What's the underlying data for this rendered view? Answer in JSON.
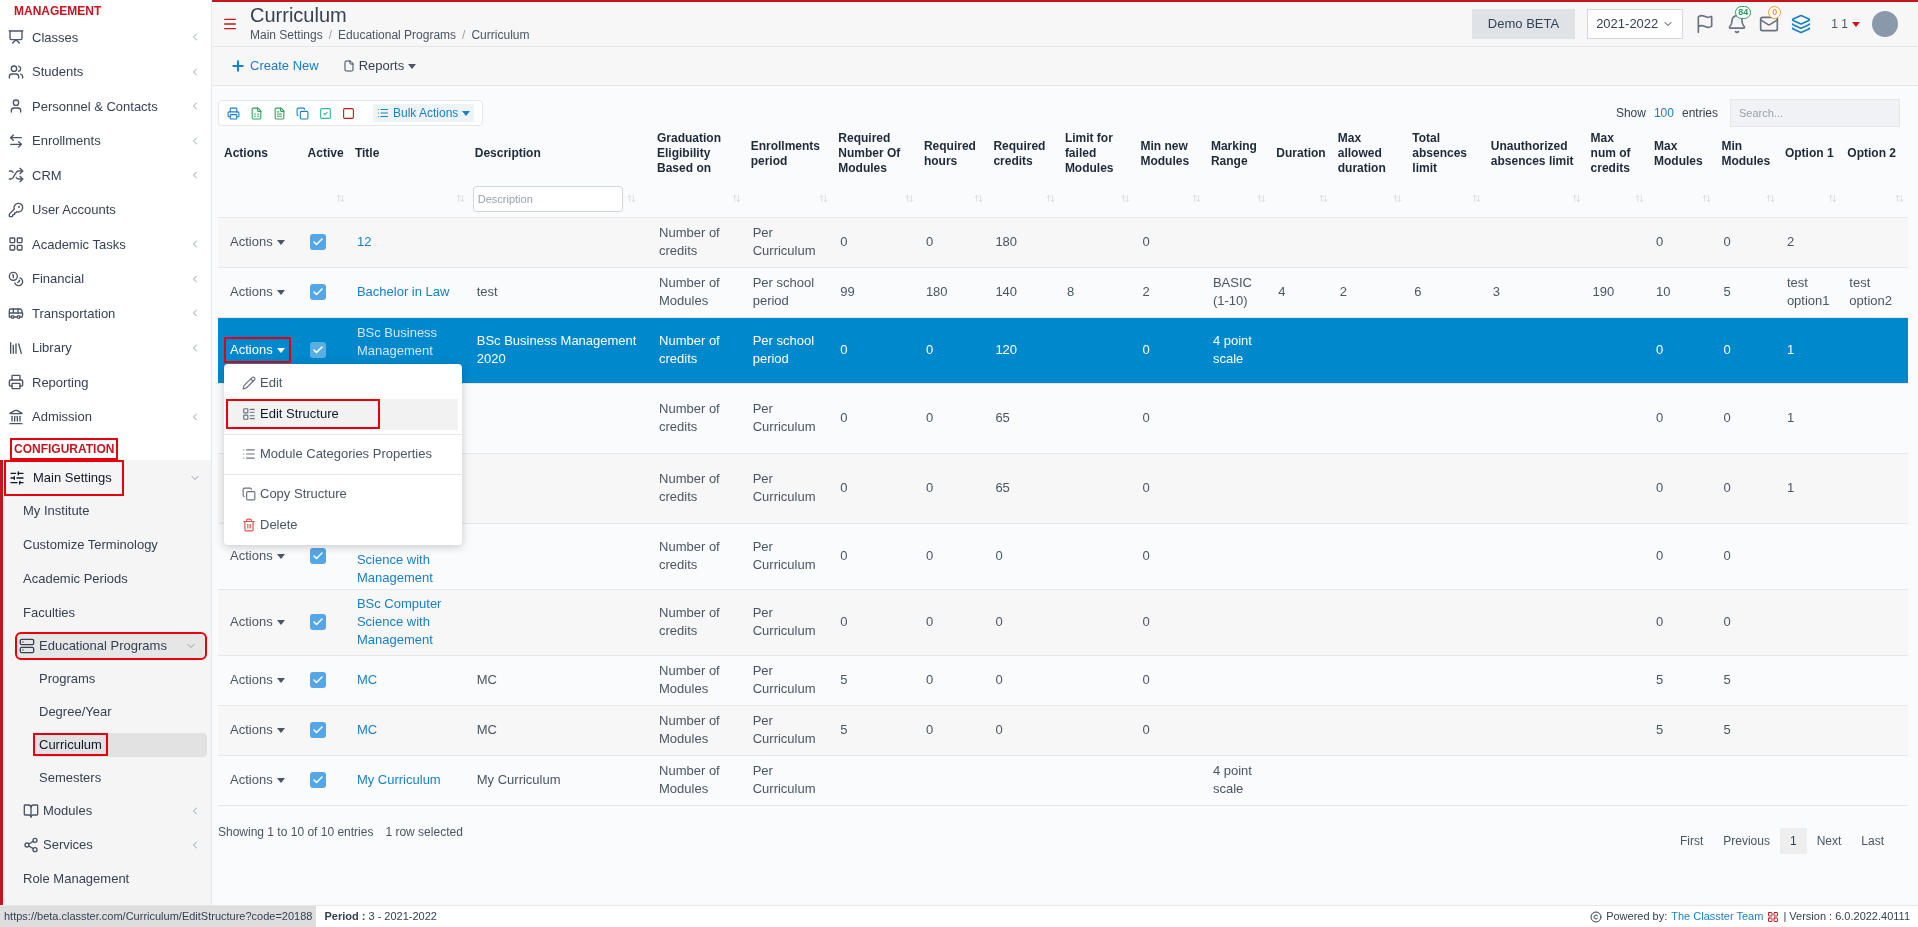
{
  "sidebar": {
    "sections": [
      {
        "heading": "MANAGEMENT",
        "annotated": false,
        "items": [
          {
            "label": "Classes",
            "expanded": false
          },
          {
            "label": "Students",
            "expanded": false
          },
          {
            "label": "Personnel & Contacts",
            "expanded": false
          },
          {
            "label": "Enrollments",
            "expanded": false
          },
          {
            "label": "CRM",
            "expanded": false
          },
          {
            "label": "User Accounts"
          },
          {
            "label": "Academic Tasks",
            "expanded": false
          },
          {
            "label": "Financial",
            "expanded": false
          },
          {
            "label": "Transportation",
            "expanded": false
          },
          {
            "label": "Library",
            "expanded": false
          },
          {
            "label": "Reporting"
          },
          {
            "label": "Admission",
            "expanded": false
          }
        ]
      },
      {
        "heading": "CONFIGURATION",
        "annotated": true,
        "items": [
          {
            "label": "Main Settings",
            "expanded": true,
            "annotated": true,
            "children": [
              {
                "label": "My Institute"
              },
              {
                "label": "Customize Terminology"
              },
              {
                "label": "Academic Periods"
              },
              {
                "label": "Faculties"
              },
              {
                "label": "Educational Programs",
                "expanded": true,
                "annotated": true,
                "children": [
                  {
                    "label": "Programs",
                    "selected": false,
                    "annotated": false
                  },
                  {
                    "label": "Degree/Year",
                    "selected": false,
                    "annotated": false
                  },
                  {
                    "label": "Curriculum",
                    "selected": true,
                    "annotated": true
                  },
                  {
                    "label": "Semesters",
                    "selected": false,
                    "annotated": false
                  }
                ]
              },
              {
                "label": "Modules",
                "expanded": false
              },
              {
                "label": "Services",
                "expanded": false
              },
              {
                "label": "Role Management"
              }
            ]
          }
        ]
      }
    ]
  },
  "header": {
    "title": "Curriculum",
    "breadcrumb": [
      "Main Settings",
      "Educational Programs",
      "Curriculum"
    ],
    "breadcrumb_separator": "/",
    "env_button": "Demo BETA",
    "year": "2021-2022",
    "notifications": "84",
    "messages": "0",
    "user": "1 1"
  },
  "toolbar": [
    "Create New",
    "Reports"
  ],
  "table_tools": {
    "bulk_actions": "Bulk Actions",
    "show": "Show",
    "entries_count": "100",
    "entries": "entries",
    "search_placeholder": "Search...",
    "description_filter_placeholder": "Description"
  },
  "table": {
    "columns": [
      "Actions",
      "Active",
      "Title",
      "Description",
      "Graduation Eligibility Based on",
      "Enrollments period",
      "Required Number Of Modules",
      "Required hours",
      "Required credits",
      "Limit for failed Modules",
      "Min new Modules",
      "Marking Range",
      "Duration",
      "Max allowed duration",
      "Total absences limit",
      "Unauthorized absences limit",
      "Max num of credits",
      "Max Modules",
      "Min Modules",
      "Option 1",
      "Option 2"
    ],
    "rows": [
      {
        "selected": false,
        "actions": "Actions",
        "active": true,
        "title": "12",
        "graduation": "Number of credits",
        "enrollments": "Per Curriculum",
        "req_modules": "0",
        "req_hours": "0",
        "req_credits": "180",
        "min_new": "0",
        "max_modules": "0",
        "min_modules": "0",
        "option_1": "2"
      },
      {
        "selected": false,
        "actions": "Actions",
        "active": true,
        "title": "Bachelor in Law",
        "description": "test",
        "graduation": "Number of Modules",
        "enrollments": "Per school period",
        "req_modules": "99",
        "req_hours": "180",
        "req_credits": "140",
        "limit_failed": "8",
        "min_new": "2",
        "marking": "BASIC (1-10)",
        "duration": "4",
        "max_duration": "2",
        "total_absences": "6",
        "unauthorized_absences": "3",
        "max_credits": "190",
        "max_modules": "10",
        "min_modules": "5",
        "option_1": "test option1",
        "option_2": "test option2"
      },
      {
        "selected": true,
        "actions": "Actions",
        "actions_annotated": true,
        "active": true,
        "title": "BSc Business Management",
        "description": "BSc Business Management 2020",
        "graduation": "Number of credits",
        "enrollments": "Per school period",
        "req_modules": "0",
        "req_hours": "0",
        "req_credits": "120",
        "min_new": "0",
        "marking": "4 point scale",
        "max_modules": "0",
        "min_modules": "0",
        "option_1": "1"
      },
      {
        "selected": false,
        "graduation": "Number of credits",
        "enrollments": "Per Curriculum",
        "req_modules": "0",
        "req_hours": "0",
        "req_credits": "65",
        "min_new": "0",
        "max_modules": "0",
        "min_modules": "0",
        "option_1": "1"
      },
      {
        "selected": false,
        "graduation": "Number of credits",
        "enrollments": "Per Curriculum",
        "req_modules": "0",
        "req_hours": "0",
        "req_credits": "65",
        "min_new": "0",
        "max_modules": "0",
        "min_modules": "0",
        "option_1": "1"
      },
      {
        "selected": false,
        "actions": "Actions",
        "active": true,
        "title": "Science with Management",
        "graduation": "Number of credits",
        "enrollments": "Per Curriculum",
        "req_modules": "0",
        "req_hours": "0",
        "req_credits": "0",
        "min_new": "0",
        "max_modules": "0",
        "min_modules": "0"
      },
      {
        "selected": false,
        "actions": "Actions",
        "active": true,
        "title": "BSc Computer Science with Management",
        "graduation": "Number of credits",
        "enrollments": "Per Curriculum",
        "req_modules": "0",
        "req_hours": "0",
        "req_credits": "0",
        "min_new": "0",
        "max_modules": "0",
        "min_modules": "0"
      },
      {
        "selected": false,
        "actions": "Actions",
        "active": true,
        "title": "MC",
        "description": "MC",
        "graduation": "Number of Modules",
        "enrollments": "Per Curriculum",
        "req_modules": "5",
        "req_hours": "0",
        "req_credits": "0",
        "min_new": "0",
        "max_modules": "5",
        "min_modules": "5"
      },
      {
        "selected": false,
        "actions": "Actions",
        "active": true,
        "title": "MC",
        "description": "MC",
        "graduation": "Number of Modules",
        "enrollments": "Per Curriculum",
        "req_modules": "5",
        "req_hours": "0",
        "req_credits": "0",
        "min_new": "0",
        "max_modules": "5",
        "min_modules": "5"
      },
      {
        "selected": false,
        "actions": "Actions",
        "active": true,
        "title": "My Curriculum",
        "description": "My Curriculum",
        "graduation": "Number of Modules",
        "enrollments": "Per Curriculum",
        "marking": "4 point scale"
      }
    ]
  },
  "actions_menu": [
    {
      "label": "Edit",
      "selected": false,
      "annotated": false
    },
    {
      "label": "Edit Structure",
      "selected": true,
      "annotated": true
    },
    {
      "label": "Module Categories Properties",
      "selected": false,
      "annotated": false
    },
    {
      "label": "Copy Structure",
      "selected": false,
      "annotated": false
    },
    {
      "label": "Delete",
      "selected": false,
      "annotated": false
    }
  ],
  "table_footer": {
    "info": "Showing 1 to 10 of 10 entries",
    "selection": "1 row selected"
  },
  "pagination": [
    {
      "label": "First",
      "selected": false
    },
    {
      "label": "Previous",
      "selected": false
    },
    {
      "label": "1",
      "selected": true
    },
    {
      "label": "Next",
      "selected": false
    },
    {
      "label": "Last",
      "selected": false
    }
  ],
  "status_bar": {
    "url": "https://beta.classter.com/Curriculum/EditStructure?code=20188",
    "period": "**Period :** 3 - 2021-2022",
    "powered_by": "Powered by:",
    "team": "The Classter Team",
    "version": "| Version : 6.0.2022.40111"
  }
}
